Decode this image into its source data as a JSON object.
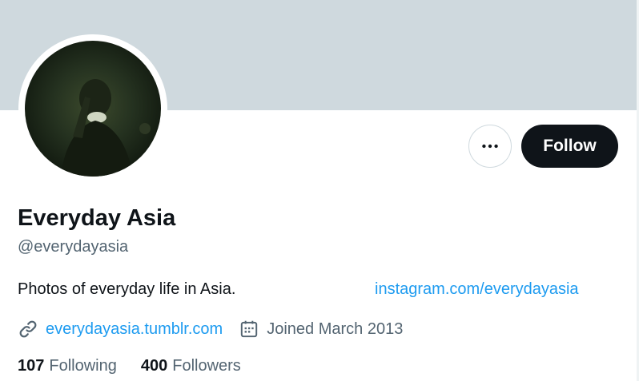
{
  "profile": {
    "display_name": "Everyday Asia",
    "handle": "@everydayasia",
    "bio": "Photos of everyday life in Asia.",
    "bio_link": "instagram.com/everydayasia",
    "website": "everydayasia.tumblr.com",
    "joined": "Joined March 2013"
  },
  "actions": {
    "follow_label": "Follow",
    "more_icon": "more-horizontal-icon"
  },
  "stats": {
    "following_count": "107",
    "following_label": "Following",
    "followers_count": "400",
    "followers_label": "Followers"
  },
  "icons": {
    "link": "link-icon",
    "calendar": "calendar-icon"
  },
  "colors": {
    "banner": "#cfd9de",
    "link": "#1d9bf0",
    "follow_button": "#0f1419",
    "secondary_text": "#536471"
  }
}
